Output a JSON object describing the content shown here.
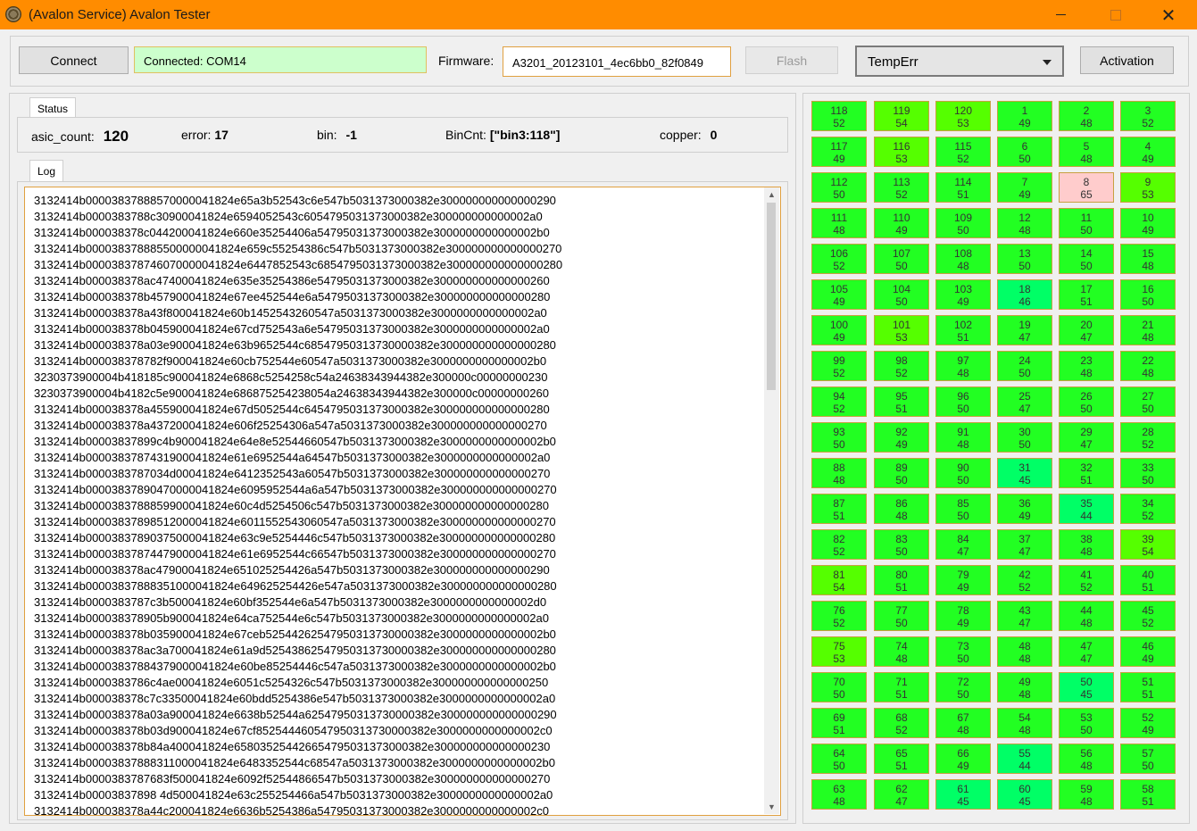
{
  "window": {
    "title": "(Avalon Service) Avalon Tester"
  },
  "toolbar": {
    "connect_label": "Connect",
    "connection_status": "Connected: COM14",
    "firmware_label": "Firmware:",
    "firmware_value": "A3201_20123101_4ec6bb0_82f0849",
    "flash_label": "Flash",
    "mode_selected": "TempErr",
    "activation_label": "Activation"
  },
  "status_tab": "Status",
  "status": {
    "asic_count_label": "asic_count:",
    "asic_count": "120",
    "error_label": "error:",
    "error": "17",
    "bin_label": "bin:",
    "bin": "-1",
    "bincnt_label": "BinCnt:",
    "bincnt": "[\"bin3:118\"]",
    "copper_label": "copper:",
    "copper": "0"
  },
  "log_tab": "Log",
  "log_lines": [
    "3132414b00003837888570000041824e65a3b52543c6e547b5031373000382e300000000000000290",
    "3132414b0000383788c30900041824e6594052543c6054795031373000382e300000000000002a0",
    "3132414b000038378c044200041824e660e35254406a54795031373000382e3000000000000002b0",
    "3132414b000038378885500000041824e659c55254386c547b5031373000382e300000000000000270",
    "3132414b000038378746070000041824e6447852543c6854795031373000382e300000000000000280",
    "3132414b000038378ac47400041824e635e35254386e54795031373000382e300000000000000260",
    "3132414b000038378b457900041824e67ee452544e6a54795031373000382e300000000000000280",
    "3132414b000038378a43f800041824e60b1452543260547a5031373000382e3000000000000002a0",
    "3132414b000038378b045900041824e67cd752543a6e54795031373000382e3000000000000002a0",
    "3132414b000038378a03e900041824e63b9652544c68547950313730000382e300000000000000280",
    "3132414b000038378782f900041824e60cb752544e60547a5031373000382e3000000000000002b0",
    "3230373900004b418185c900041824e6868c5254258c54a24638343944382e300000c00000000230",
    "3230373900004b4182c5e900041824e686875254238054a24638343944382e300000c00000000260",
    "3132414b000038378a455900041824e67d5052544c6454795031373000382e300000000000000280",
    "3132414b000038378a437200041824e606f25254306a547a5031373000382e300000000000000270",
    "3132414b00003837899c4b900041824e64e8e52544660547b5031373000382e3000000000000002b0",
    "3132414b0000383787431900041824e61e6952544a64547b5031373000382e3000000000000002a0",
    "3132414b0000383787034d00041824e6412352543a60547b5031373000382e300000000000000270",
    "3132414b00003837890470000041824e6095952544a6a547b5031373000382e300000000000000270",
    "3132414b0000383788859900041824e60c4d5254506c547b5031373000382e300000000000000280",
    "3132414b00003837898512000041824e6011552543060547a5031373000382e300000000000000270",
    "3132414b00003837890375000041824e63c9e5254446c547b5031373000382e300000000000000280",
    "3132414b00003837874479000041824e61e6952544c66547b5031373000382e300000000000000270",
    "3132414b000038378ac47900041824e651025254426a547b5031373000382e300000000000000290",
    "3132414b00003837888351000041824e649625254426e547a5031373000382e300000000000000280",
    "3132414b0000383787c3b500041824e60bf352544e6a547b5031373000382e3000000000000002d0",
    "3132414b000038378905b900041824e64ca752544e6c547b5031373000382e3000000000000002a0",
    "3132414b000038378b035900041824e67ceb52544262547950313730000382e3000000000000002b0",
    "3132414b000038378ac3a700041824e61a9d52543862547950313730000382e300000000000000280",
    "3132414b00003837884379000041824e60be85254446c547a5031373000382e3000000000000002b0",
    "3132414b0000383786c4ae00041824e6051c5254326c547b5031373000382e300000000000000250",
    "3132414b000038378c7c33500041824e60bdd5254386e547b5031373000382e3000000000000002a0",
    "3132414b000038378a03a900041824e6638b52544a62547950313730000382e300000000000000290",
    "3132414b000038378b03d900041824e67cf852544460547950313730000382e3000000000000002c0",
    "3132414b000038378b84a400041824e658035254426654795031373000382e300000000000000230",
    "3132414b00003837888311000041824e6483352544c68547a5031373000382e3000000000000002b0",
    "3132414b0000383787683f500041824e6092f52544866547b5031373000382e300000000000000270",
    "3132414b00003837898 4d500041824e63c255254466a547b5031373000382e3000000000000002a0",
    "3132414b000038378a44c200041824e6636b5254386a54795031373000382e3000000000000002c0"
  ],
  "grid": {
    "rows": [
      [
        [
          "118",
          "52"
        ],
        [
          "119",
          "54"
        ],
        [
          "120",
          "53"
        ],
        [
          "1",
          "49"
        ],
        [
          "2",
          "48"
        ],
        [
          "3",
          "52"
        ]
      ],
      [
        [
          "117",
          "49"
        ],
        [
          "116",
          "53"
        ],
        [
          "115",
          "52"
        ],
        [
          "6",
          "50"
        ],
        [
          "5",
          "48"
        ],
        [
          "4",
          "49"
        ]
      ],
      [
        [
          "112",
          "50"
        ],
        [
          "113",
          "52"
        ],
        [
          "114",
          "51"
        ],
        [
          "7",
          "49"
        ],
        [
          "8",
          "65"
        ],
        [
          "9",
          "53"
        ]
      ],
      [
        [
          "111",
          "48"
        ],
        [
          "110",
          "49"
        ],
        [
          "109",
          "50"
        ],
        [
          "12",
          "48"
        ],
        [
          "11",
          "50"
        ],
        [
          "10",
          "49"
        ]
      ],
      [
        [
          "106",
          "52"
        ],
        [
          "107",
          "50"
        ],
        [
          "108",
          "48"
        ],
        [
          "13",
          "50"
        ],
        [
          "14",
          "50"
        ],
        [
          "15",
          "48"
        ]
      ],
      [
        [
          "105",
          "49"
        ],
        [
          "104",
          "50"
        ],
        [
          "103",
          "49"
        ],
        [
          "18",
          "46"
        ],
        [
          "17",
          "51"
        ],
        [
          "16",
          "50"
        ]
      ],
      [
        [
          "100",
          "49"
        ],
        [
          "101",
          "53"
        ],
        [
          "102",
          "51"
        ],
        [
          "19",
          "47"
        ],
        [
          "20",
          "47"
        ],
        [
          "21",
          "48"
        ]
      ],
      [
        [
          "99",
          "52"
        ],
        [
          "98",
          "52"
        ],
        [
          "97",
          "48"
        ],
        [
          "24",
          "50"
        ],
        [
          "23",
          "48"
        ],
        [
          "22",
          "48"
        ]
      ],
      [
        [
          "94",
          "52"
        ],
        [
          "95",
          "51"
        ],
        [
          "96",
          "50"
        ],
        [
          "25",
          "47"
        ],
        [
          "26",
          "50"
        ],
        [
          "27",
          "50"
        ]
      ],
      [
        [
          "93",
          "50"
        ],
        [
          "92",
          "49"
        ],
        [
          "91",
          "48"
        ],
        [
          "30",
          "50"
        ],
        [
          "29",
          "47"
        ],
        [
          "28",
          "52"
        ]
      ],
      [
        [
          "88",
          "48"
        ],
        [
          "89",
          "50"
        ],
        [
          "90",
          "50"
        ],
        [
          "31",
          "45"
        ],
        [
          "32",
          "51"
        ],
        [
          "33",
          "50"
        ]
      ],
      [
        [
          "87",
          "51"
        ],
        [
          "86",
          "48"
        ],
        [
          "85",
          "50"
        ],
        [
          "36",
          "49"
        ],
        [
          "35",
          "44"
        ],
        [
          "34",
          "52"
        ]
      ],
      [
        [
          "82",
          "52"
        ],
        [
          "83",
          "50"
        ],
        [
          "84",
          "47"
        ],
        [
          "37",
          "47"
        ],
        [
          "38",
          "48"
        ],
        [
          "39",
          "54"
        ]
      ],
      [
        [
          "81",
          "54"
        ],
        [
          "80",
          "51"
        ],
        [
          "79",
          "49"
        ],
        [
          "42",
          "52"
        ],
        [
          "41",
          "52"
        ],
        [
          "40",
          "51"
        ]
      ],
      [
        [
          "76",
          "52"
        ],
        [
          "77",
          "50"
        ],
        [
          "78",
          "49"
        ],
        [
          "43",
          "47"
        ],
        [
          "44",
          "48"
        ],
        [
          "45",
          "52"
        ]
      ],
      [
        [
          "75",
          "53"
        ],
        [
          "74",
          "48"
        ],
        [
          "73",
          "50"
        ],
        [
          "48",
          "48"
        ],
        [
          "47",
          "47"
        ],
        [
          "46",
          "49"
        ]
      ],
      [
        [
          "70",
          "50"
        ],
        [
          "71",
          "51"
        ],
        [
          "72",
          "50"
        ],
        [
          "49",
          "48"
        ],
        [
          "50",
          "45"
        ],
        [
          "51",
          "51"
        ]
      ],
      [
        [
          "69",
          "51"
        ],
        [
          "68",
          "52"
        ],
        [
          "67",
          "48"
        ],
        [
          "54",
          "48"
        ],
        [
          "53",
          "50"
        ],
        [
          "52",
          "49"
        ]
      ],
      [
        [
          "64",
          "50"
        ],
        [
          "65",
          "51"
        ],
        [
          "66",
          "49"
        ],
        [
          "55",
          "44"
        ],
        [
          "56",
          "48"
        ],
        [
          "57",
          "50"
        ]
      ],
      [
        [
          "63",
          "48"
        ],
        [
          "62",
          "47"
        ],
        [
          "61",
          "45"
        ],
        [
          "60",
          "45"
        ],
        [
          "59",
          "48"
        ],
        [
          "58",
          "51"
        ]
      ]
    ],
    "colors": {
      "hot": "#ffcccc",
      "cool": "#00ff66",
      "mid": "#22ff22",
      "warm": "#55ff00"
    }
  }
}
